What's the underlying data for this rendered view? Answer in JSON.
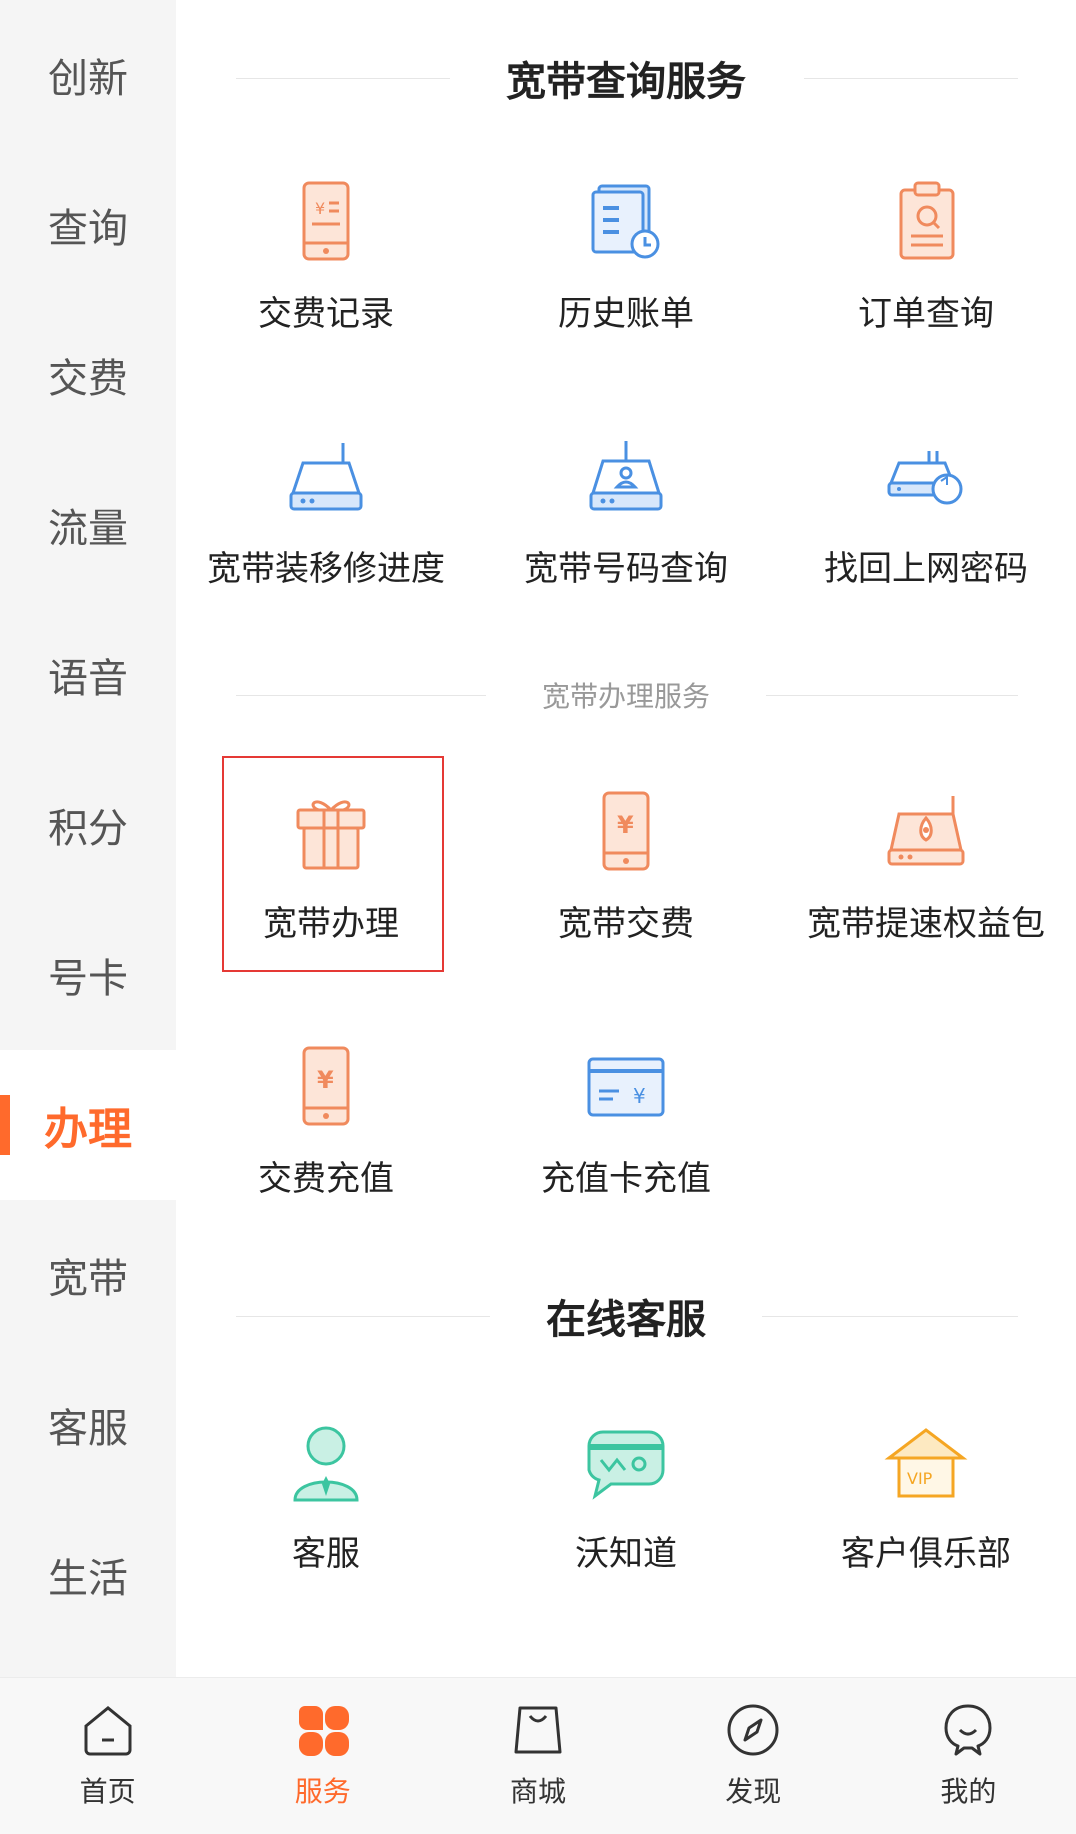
{
  "sidebar": {
    "items": [
      {
        "label": "创新"
      },
      {
        "label": "查询"
      },
      {
        "label": "交费"
      },
      {
        "label": "流量"
      },
      {
        "label": "语音"
      },
      {
        "label": "积分"
      },
      {
        "label": "号卡"
      },
      {
        "label": "办理",
        "active": true
      },
      {
        "label": "宽带"
      },
      {
        "label": "客服"
      },
      {
        "label": "生活"
      }
    ]
  },
  "sections": {
    "query": {
      "title": "宽带查询服务",
      "items": [
        {
          "label": "交费记录",
          "icon": "payment-record-icon"
        },
        {
          "label": "历史账单",
          "icon": "history-bill-icon"
        },
        {
          "label": "订单查询",
          "icon": "order-query-icon"
        },
        {
          "label": "宽带装移修进度",
          "icon": "broadband-progress-icon"
        },
        {
          "label": "宽带号码查询",
          "icon": "broadband-number-icon"
        },
        {
          "label": "找回上网密码",
          "icon": "password-reset-icon"
        }
      ]
    },
    "handle": {
      "title": "宽带办理服务",
      "items": [
        {
          "label": "宽带办理",
          "icon": "gift-icon",
          "highlighted": true
        },
        {
          "label": "宽带交费",
          "icon": "broadband-payment-icon"
        },
        {
          "label": "宽带提速权益包",
          "icon": "speedup-icon"
        },
        {
          "label": "交费充值",
          "icon": "recharge-icon"
        },
        {
          "label": "充值卡充值",
          "icon": "card-recharge-icon"
        }
      ]
    },
    "service": {
      "title": "在线客服",
      "items": [
        {
          "label": "客服",
          "icon": "customer-service-icon"
        },
        {
          "label": "沃知道",
          "icon": "chat-icon"
        },
        {
          "label": "客户俱乐部",
          "icon": "vip-club-icon",
          "badge": "VIP"
        }
      ]
    }
  },
  "tabbar": {
    "items": [
      {
        "label": "首页",
        "icon": "home-icon"
      },
      {
        "label": "服务",
        "icon": "service-grid-icon",
        "active": true
      },
      {
        "label": "商城",
        "icon": "shopping-bag-icon"
      },
      {
        "label": "发现",
        "icon": "compass-icon"
      },
      {
        "label": "我的",
        "icon": "profile-icon"
      }
    ]
  },
  "colors": {
    "accent": "#ff6a2c",
    "orange_icon": "#f08a5d",
    "blue_icon": "#4a90e2",
    "green_icon": "#3cc5a0",
    "yellow_icon": "#f5a623",
    "highlight_border": "#e53935"
  }
}
